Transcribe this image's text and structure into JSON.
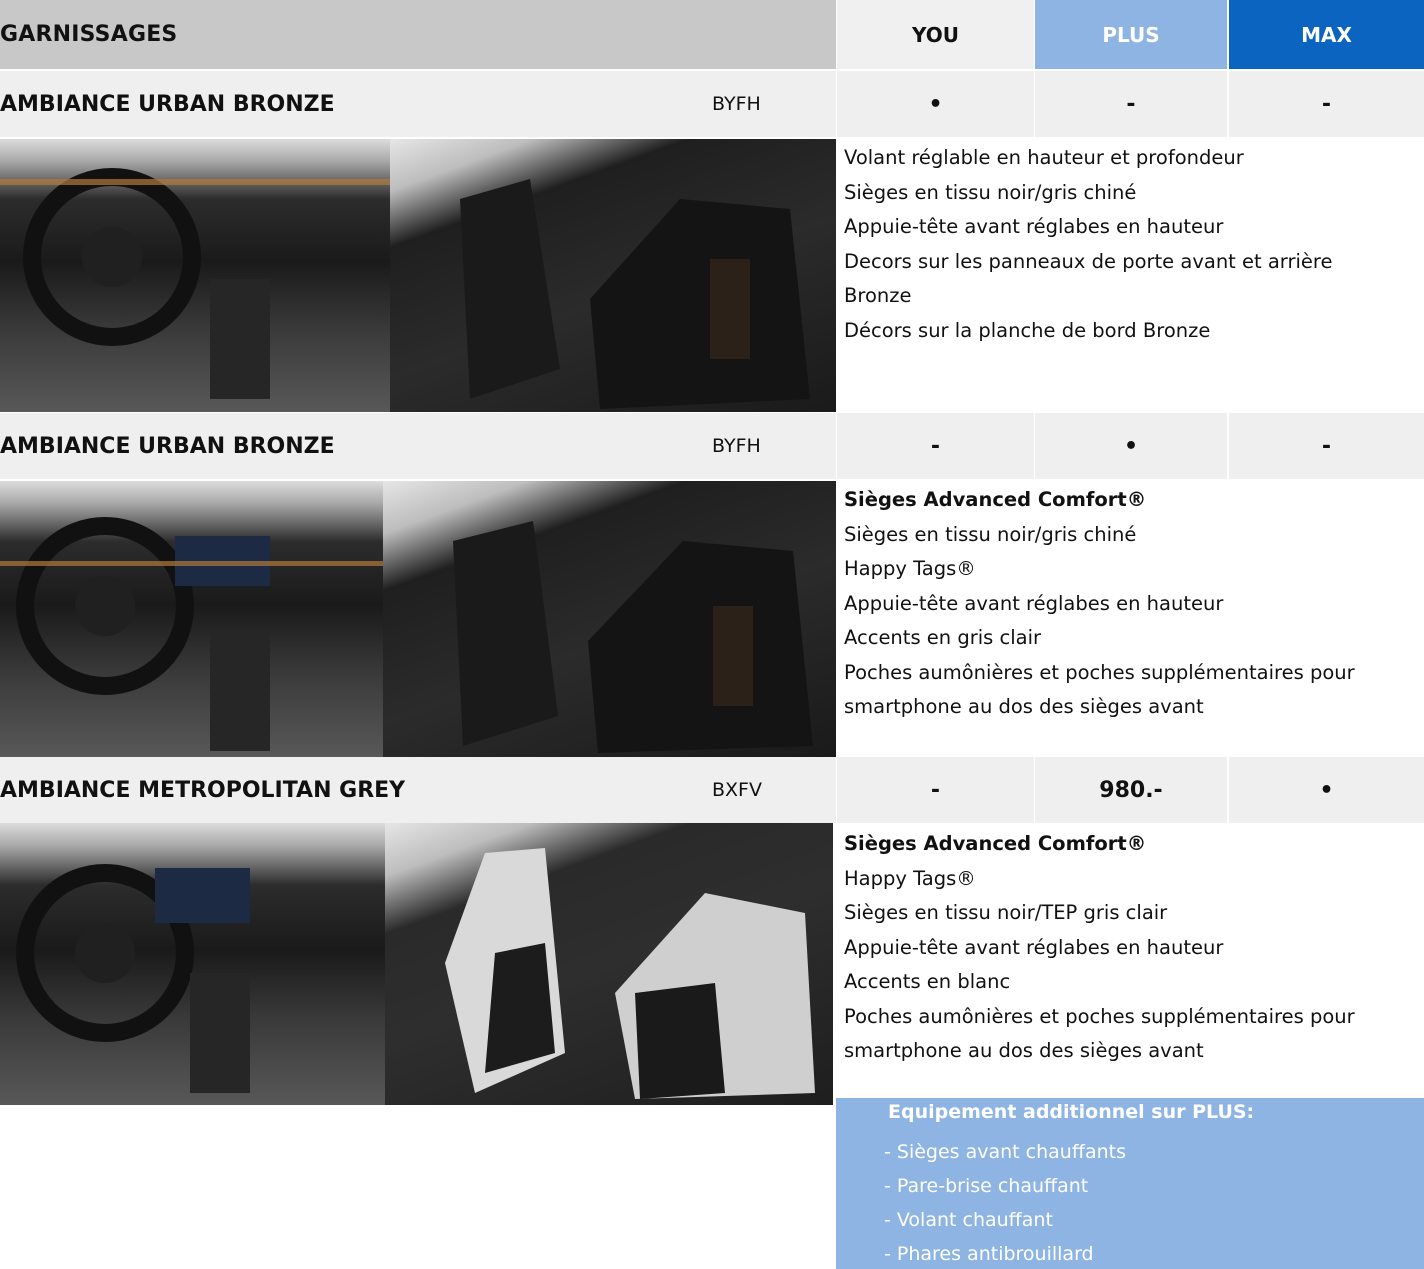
{
  "header": {
    "title": "GARNISSAGES",
    "columns": [
      "YOU",
      "PLUS",
      "MAX"
    ]
  },
  "rows": [
    {
      "name": "AMBIANCE URBAN BRONZE",
      "code": "BYFH",
      "values": [
        "•",
        "-",
        "-"
      ],
      "features": [
        "Volant réglable en hauteur et profondeur",
        "Sièges en tissu noir/gris chiné",
        "Appuie-tête avant réglabes en hauteur",
        "Decors sur les panneaux de porte avant et arrière",
        "Bronze",
        "Décors sur la planche de bord Bronze"
      ]
    },
    {
      "name": "AMBIANCE URBAN BRONZE",
      "code": "BYFH",
      "values": [
        "-",
        "•",
        "-"
      ],
      "features_title": "Sièges Advanced Comfort®",
      "features": [
        "Sièges en tissu noir/gris chiné",
        "Happy Tags®",
        "Appuie-tête avant réglabes en hauteur",
        "Accents en gris clair",
        "Poches aumônières et poches supplémentaires pour",
        "smartphone au dos des sièges avant"
      ]
    },
    {
      "name": "AMBIANCE METROPOLITAN GREY",
      "code": "BXFV",
      "values": [
        "-",
        "980.-",
        "•"
      ],
      "features_title": "Sièges Advanced Comfort®",
      "features": [
        "Happy Tags®",
        "Sièges en tissu noir/TEP gris clair",
        "Appuie-tête avant réglabes en hauteur",
        "Accents en blanc",
        "Poches aumônières et poches supplémentaires pour",
        "smartphone au dos des sièges avant"
      ]
    }
  ],
  "additional": {
    "title": "Equipement additionnel sur PLUS:",
    "items": [
      "- Sièges avant chauffants",
      "- Pare-brise chauffant",
      "- Volant chauffant",
      "- Phares antibrouillard"
    ]
  },
  "colors": {
    "header_grey": "#c8c8c8",
    "row_grey": "#efefef",
    "plus_blue": "#8eb4e3",
    "max_blue": "#0b64c0"
  }
}
